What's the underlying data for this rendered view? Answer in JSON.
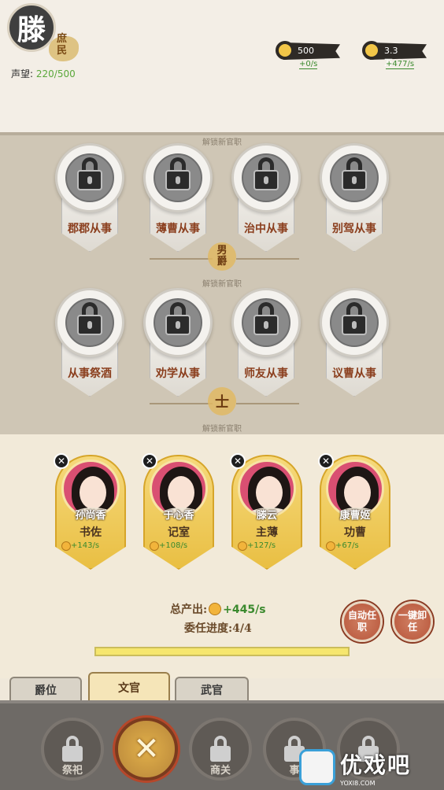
{
  "player": {
    "family_char": "滕",
    "rank": "庶民",
    "fame_label": "声望:",
    "fame_value": "220/500"
  },
  "resources": [
    {
      "icon": "food-icon",
      "value": "500",
      "rate": "+0/s"
    },
    {
      "icon": "coin-icon",
      "value": "3.3万",
      "rate": "+477/s"
    }
  ],
  "board": {
    "unlock_hint": "解锁新官职",
    "row1": [
      "郡郡从事",
      "薄曹从事",
      "治中从事",
      "别驾从事"
    ],
    "row1_rank": "男爵",
    "row2": [
      "从事祭酒",
      "劝学从事",
      "师友从事",
      "议曹从事"
    ],
    "row2_rank": "士"
  },
  "officials": [
    {
      "name": "孙尚香",
      "post": "书佐",
      "rate": "+143/s"
    },
    {
      "name": "于心香",
      "post": "记室",
      "rate": "+108/s"
    },
    {
      "name": "滕云",
      "post": "主薄",
      "rate": "+127/s"
    },
    {
      "name": "康曹姬",
      "post": "功曹",
      "rate": "+67/s"
    }
  ],
  "summary": {
    "total_label": "总产出:",
    "total_value": "+445/s",
    "progress_label": "委任进度:4/4",
    "progress_fraction": 1.0
  },
  "actions": {
    "auto_assign": "自动任职",
    "dismiss_all": "一键卸任"
  },
  "tabs": [
    "爵位",
    "文官",
    "武官"
  ],
  "bottom_nav": [
    "祭祀",
    "",
    "商关",
    "事",
    ""
  ],
  "watermark": {
    "text": "优戏吧",
    "url": "YOXI8.COM"
  }
}
